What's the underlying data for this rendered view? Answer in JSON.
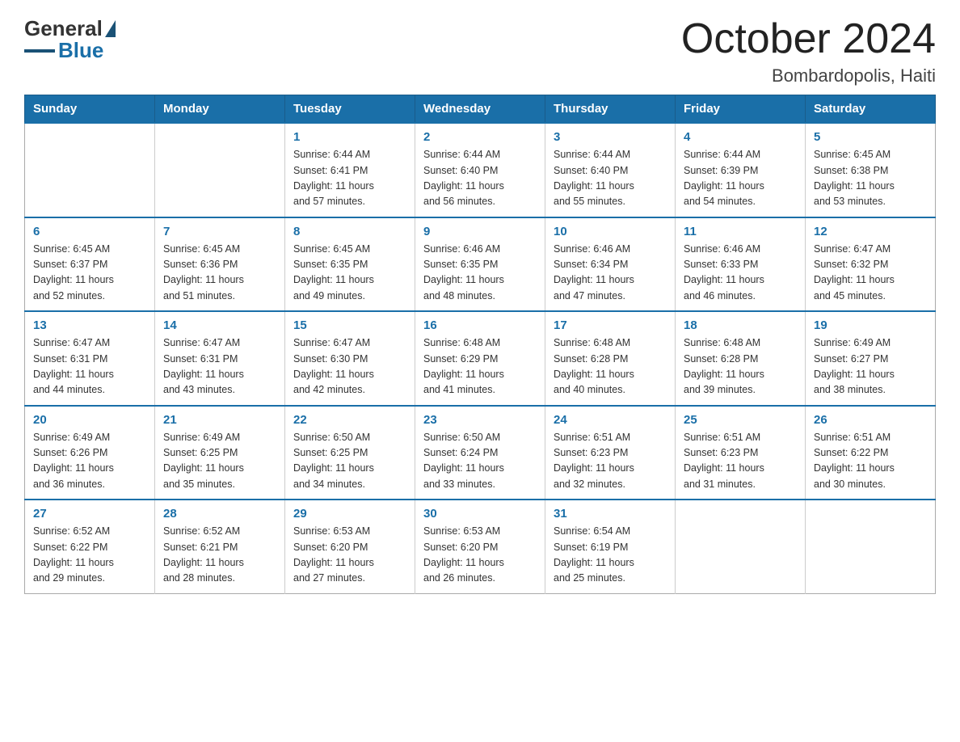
{
  "header": {
    "logo_general": "General",
    "logo_blue": "Blue",
    "month_year": "October 2024",
    "location": "Bombardopolis, Haiti"
  },
  "days_of_week": [
    "Sunday",
    "Monday",
    "Tuesday",
    "Wednesday",
    "Thursday",
    "Friday",
    "Saturday"
  ],
  "weeks": [
    [
      {
        "day": "",
        "info": ""
      },
      {
        "day": "",
        "info": ""
      },
      {
        "day": "1",
        "info": "Sunrise: 6:44 AM\nSunset: 6:41 PM\nDaylight: 11 hours\nand 57 minutes."
      },
      {
        "day": "2",
        "info": "Sunrise: 6:44 AM\nSunset: 6:40 PM\nDaylight: 11 hours\nand 56 minutes."
      },
      {
        "day": "3",
        "info": "Sunrise: 6:44 AM\nSunset: 6:40 PM\nDaylight: 11 hours\nand 55 minutes."
      },
      {
        "day": "4",
        "info": "Sunrise: 6:44 AM\nSunset: 6:39 PM\nDaylight: 11 hours\nand 54 minutes."
      },
      {
        "day": "5",
        "info": "Sunrise: 6:45 AM\nSunset: 6:38 PM\nDaylight: 11 hours\nand 53 minutes."
      }
    ],
    [
      {
        "day": "6",
        "info": "Sunrise: 6:45 AM\nSunset: 6:37 PM\nDaylight: 11 hours\nand 52 minutes."
      },
      {
        "day": "7",
        "info": "Sunrise: 6:45 AM\nSunset: 6:36 PM\nDaylight: 11 hours\nand 51 minutes."
      },
      {
        "day": "8",
        "info": "Sunrise: 6:45 AM\nSunset: 6:35 PM\nDaylight: 11 hours\nand 49 minutes."
      },
      {
        "day": "9",
        "info": "Sunrise: 6:46 AM\nSunset: 6:35 PM\nDaylight: 11 hours\nand 48 minutes."
      },
      {
        "day": "10",
        "info": "Sunrise: 6:46 AM\nSunset: 6:34 PM\nDaylight: 11 hours\nand 47 minutes."
      },
      {
        "day": "11",
        "info": "Sunrise: 6:46 AM\nSunset: 6:33 PM\nDaylight: 11 hours\nand 46 minutes."
      },
      {
        "day": "12",
        "info": "Sunrise: 6:47 AM\nSunset: 6:32 PM\nDaylight: 11 hours\nand 45 minutes."
      }
    ],
    [
      {
        "day": "13",
        "info": "Sunrise: 6:47 AM\nSunset: 6:31 PM\nDaylight: 11 hours\nand 44 minutes."
      },
      {
        "day": "14",
        "info": "Sunrise: 6:47 AM\nSunset: 6:31 PM\nDaylight: 11 hours\nand 43 minutes."
      },
      {
        "day": "15",
        "info": "Sunrise: 6:47 AM\nSunset: 6:30 PM\nDaylight: 11 hours\nand 42 minutes."
      },
      {
        "day": "16",
        "info": "Sunrise: 6:48 AM\nSunset: 6:29 PM\nDaylight: 11 hours\nand 41 minutes."
      },
      {
        "day": "17",
        "info": "Sunrise: 6:48 AM\nSunset: 6:28 PM\nDaylight: 11 hours\nand 40 minutes."
      },
      {
        "day": "18",
        "info": "Sunrise: 6:48 AM\nSunset: 6:28 PM\nDaylight: 11 hours\nand 39 minutes."
      },
      {
        "day": "19",
        "info": "Sunrise: 6:49 AM\nSunset: 6:27 PM\nDaylight: 11 hours\nand 38 minutes."
      }
    ],
    [
      {
        "day": "20",
        "info": "Sunrise: 6:49 AM\nSunset: 6:26 PM\nDaylight: 11 hours\nand 36 minutes."
      },
      {
        "day": "21",
        "info": "Sunrise: 6:49 AM\nSunset: 6:25 PM\nDaylight: 11 hours\nand 35 minutes."
      },
      {
        "day": "22",
        "info": "Sunrise: 6:50 AM\nSunset: 6:25 PM\nDaylight: 11 hours\nand 34 minutes."
      },
      {
        "day": "23",
        "info": "Sunrise: 6:50 AM\nSunset: 6:24 PM\nDaylight: 11 hours\nand 33 minutes."
      },
      {
        "day": "24",
        "info": "Sunrise: 6:51 AM\nSunset: 6:23 PM\nDaylight: 11 hours\nand 32 minutes."
      },
      {
        "day": "25",
        "info": "Sunrise: 6:51 AM\nSunset: 6:23 PM\nDaylight: 11 hours\nand 31 minutes."
      },
      {
        "day": "26",
        "info": "Sunrise: 6:51 AM\nSunset: 6:22 PM\nDaylight: 11 hours\nand 30 minutes."
      }
    ],
    [
      {
        "day": "27",
        "info": "Sunrise: 6:52 AM\nSunset: 6:22 PM\nDaylight: 11 hours\nand 29 minutes."
      },
      {
        "day": "28",
        "info": "Sunrise: 6:52 AM\nSunset: 6:21 PM\nDaylight: 11 hours\nand 28 minutes."
      },
      {
        "day": "29",
        "info": "Sunrise: 6:53 AM\nSunset: 6:20 PM\nDaylight: 11 hours\nand 27 minutes."
      },
      {
        "day": "30",
        "info": "Sunrise: 6:53 AM\nSunset: 6:20 PM\nDaylight: 11 hours\nand 26 minutes."
      },
      {
        "day": "31",
        "info": "Sunrise: 6:54 AM\nSunset: 6:19 PM\nDaylight: 11 hours\nand 25 minutes."
      },
      {
        "day": "",
        "info": ""
      },
      {
        "day": "",
        "info": ""
      }
    ]
  ]
}
